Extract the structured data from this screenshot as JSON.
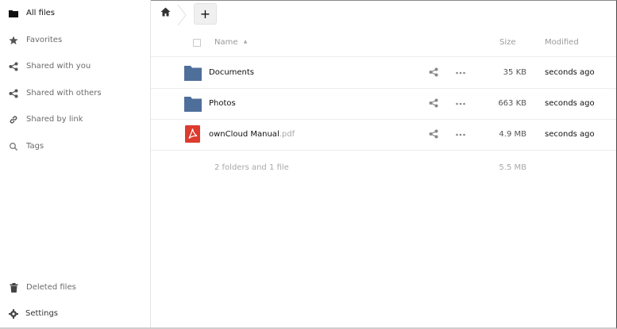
{
  "sidebar": {
    "items": [
      {
        "label": "All files",
        "icon": "folder-icon"
      },
      {
        "label": "Favorites",
        "icon": "star-icon"
      },
      {
        "label": "Shared with you",
        "icon": "share-icon"
      },
      {
        "label": "Shared with others",
        "icon": "share-icon"
      },
      {
        "label": "Shared by link",
        "icon": "link-icon"
      },
      {
        "label": "Tags",
        "icon": "search-icon"
      }
    ],
    "deleted_label": "Deleted files",
    "settings_label": "Settings"
  },
  "toolbar": {
    "add_label": "+"
  },
  "table": {
    "headers": {
      "name": "Name",
      "sort_indicator": "▲",
      "size": "Size",
      "modified": "Modified"
    },
    "rows": [
      {
        "name": "Documents",
        "ext": "",
        "type": "folder",
        "size": "35 KB",
        "modified": "seconds ago"
      },
      {
        "name": "Photos",
        "ext": "",
        "type": "folder",
        "size": "663 KB",
        "modified": "seconds ago"
      },
      {
        "name": "ownCloud Manual",
        "ext": ".pdf",
        "type": "pdf",
        "size": "4.9 MB",
        "modified": "seconds ago"
      }
    ],
    "summary": {
      "count": "2 folders and 1 file",
      "total": "5.5 MB"
    }
  },
  "colors": {
    "folder": "#4f6f9b",
    "pdf": "#dd3b2f",
    "icon_grey": "#777777"
  }
}
